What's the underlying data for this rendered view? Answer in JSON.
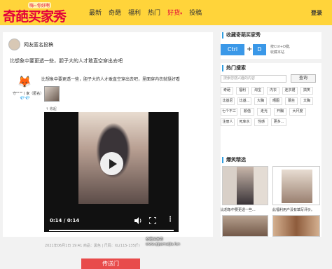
{
  "header": {
    "logo_main": "奇葩买家秀",
    "logo_sub": "嗨~你好啊",
    "nav": [
      {
        "label": "最新",
        "hot": false
      },
      {
        "label": "奇葩",
        "hot": false
      },
      {
        "label": "福利",
        "hot": false
      },
      {
        "label": "热门",
        "hot": false
      },
      {
        "label": "好货",
        "hot": true,
        "arrow": "▾"
      },
      {
        "label": "投稿",
        "hot": false
      }
    ],
    "login": "登录"
  },
  "post": {
    "author": "网友匿名投稿",
    "title": "比想象中要更透一些，胆子大的人才敢直空穿出去吧",
    "user": "守\"\"\"\"丨家（匿名）",
    "vip_badge": "💎💎",
    "text": "比想象中要更透一些，胆子大的人才敢直空穿出去吧，里面穿内衣就挺好看",
    "collapse_label": "↑ 收起",
    "video": {
      "time": "0:14 / 0:14",
      "progress": 1.0
    },
    "meta": "2021年06月1日 19:41   商品：黑色 | 尺码：XL(115-135斤)",
    "watermark": [
      "奇葩买家秀",
      "www.qipamaijia.fun"
    ],
    "portal_button": "传送门"
  },
  "sidebar": {
    "fav": {
      "title": "收藏奇葩买家秀",
      "key1": "Ctrl",
      "plus": "+",
      "key2": "D",
      "hint1": "按Ctrl+D键,",
      "hint2": "收藏本站"
    },
    "search": {
      "title": "热门搜索",
      "placeholder": "搜索您感兴趣的内容",
      "button": "查询",
      "tags": [
        [
          "奇葩",
          "福利",
          "淘宝",
          "内衣",
          "连衣裙",
          "搞笑"
        ],
        [
          "比基尼",
          "比基...",
          "大胸",
          "晒图",
          "蕾丝",
          "文胸"
        ],
        [
          "七个不三",
          "颜值",
          "走光",
          "开胸",
          "大尺度"
        ],
        [
          "注册人",
          "死库水",
          "性感",
          "更多..."
        ]
      ]
    },
    "gallery": {
      "title": "爆笑精选",
      "cards": [
        {
          "caption": "比想象中要更透一些..."
        },
        {
          "caption": "此福利用户没有填写评价。"
        },
        {
          "caption": ""
        },
        {
          "caption": ""
        }
      ]
    }
  }
}
